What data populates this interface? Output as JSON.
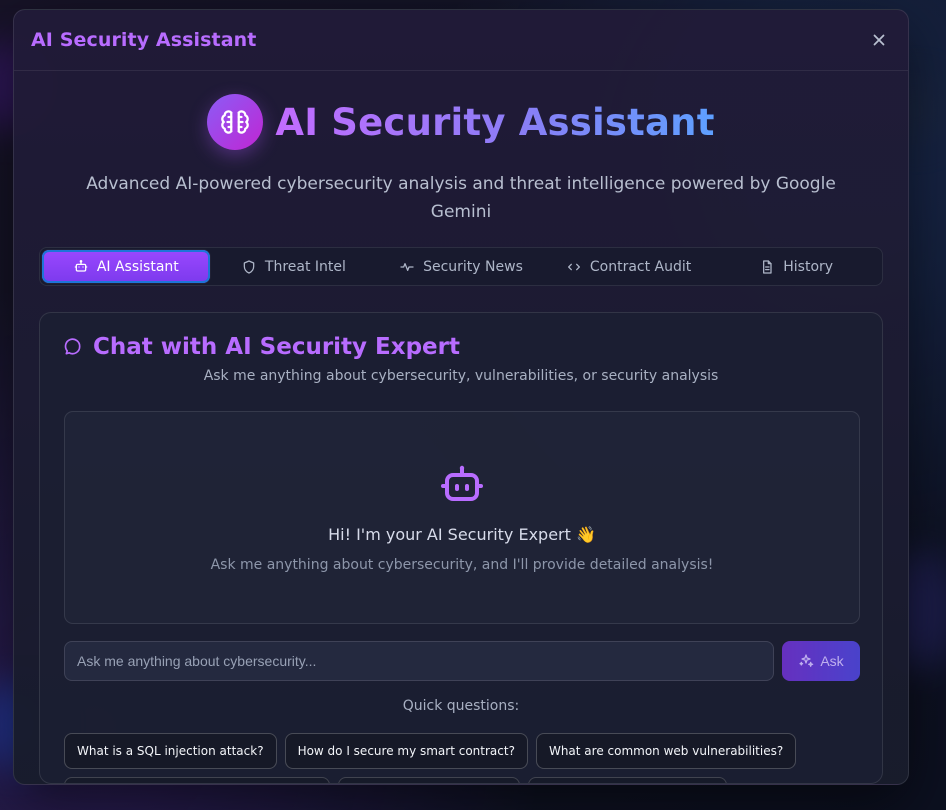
{
  "modal": {
    "title": "AI Security Assistant"
  },
  "hero": {
    "title": "AI Security Assistant",
    "subtitle": "Advanced AI-powered cybersecurity analysis and threat intelligence powered by Google Gemini"
  },
  "tabs": [
    {
      "label": "AI Assistant",
      "icon": "robot-icon"
    },
    {
      "label": "Threat Intel",
      "icon": "shield-icon"
    },
    {
      "label": "Security News",
      "icon": "activity-icon"
    },
    {
      "label": "Contract Audit",
      "icon": "code-icon"
    },
    {
      "label": "History",
      "icon": "document-icon"
    }
  ],
  "chat": {
    "title": "Chat with AI Security Expert",
    "subtitle": "Ask me anything about cybersecurity, vulnerabilities, or security analysis",
    "welcome_title": "Hi! I'm your AI Security Expert 👋",
    "welcome_text": "Ask me anything about cybersecurity, and I'll provide detailed analysis!",
    "input_placeholder": "Ask me anything about cybersecurity...",
    "ask_label": "Ask",
    "quick_label": "Quick questions:"
  },
  "quick_questions": [
    "What is a SQL injection attack?",
    "How do I secure my smart contract?",
    "What are common web vulnerabilities?"
  ],
  "colors": {
    "accent_purple": "#b86cff",
    "active_tab": "#8b3ff7",
    "focus_ring": "#1d75d8"
  }
}
